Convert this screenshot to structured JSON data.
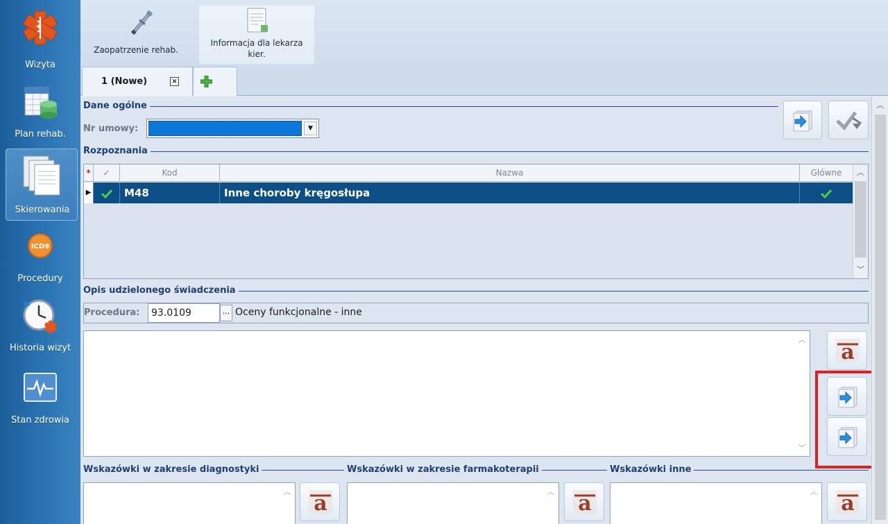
{
  "sidebar": {
    "items": [
      {
        "label": "Wizyta",
        "icon": "medical-star-icon",
        "active": false
      },
      {
        "label": "Plan rehab.",
        "icon": "calendar-database-icon",
        "active": false
      },
      {
        "label": "Skierowania",
        "icon": "documents-icon",
        "active": true
      },
      {
        "label": "Procedury",
        "icon": "icd9-icon",
        "active": false
      },
      {
        "label": "Historia wizyt",
        "icon": "clock-history-icon",
        "active": false
      },
      {
        "label": "Stan zdrowia",
        "icon": "heartbeat-monitor-icon",
        "active": false
      }
    ]
  },
  "toolbar": {
    "buttons": [
      {
        "label": "Zaopatrzenie rehab.",
        "icon": "crutch-icon"
      },
      {
        "label": "Informacja dla lekarza kier.",
        "icon": "document-info-icon",
        "active": true
      }
    ]
  },
  "tabs": {
    "items": [
      {
        "label": "1 (Nowe)",
        "close": "×"
      }
    ],
    "add_icon": "green-plus-icon"
  },
  "dane_ogolne": {
    "title": "Dane ogólne",
    "nr_umowy_label": "Nr umowy:",
    "nr_umowy_value": ""
  },
  "rozpoznania": {
    "title": "Rozpoznania",
    "columns": {
      "star": "*",
      "check": "✓",
      "kod": "Kod",
      "nazwa": "Nazwa",
      "glowne": "Główne"
    },
    "rows": [
      {
        "kod": "M48",
        "nazwa": "Inne choroby kręgosłupa",
        "checked": true,
        "glowne": true
      }
    ]
  },
  "opis": {
    "title": "Opis udzielonego świadczenia",
    "procedura_label": "Procedura:",
    "procedura_code": "93.0109",
    "procedura_button": "...",
    "procedura_name": "Oceny funkcjonalne - inne",
    "text": ""
  },
  "wskazowki": {
    "diagnostyki_title": "Wskazówki w zakresie diagnostyki",
    "farmakoterapii_title": "Wskazówki w zakresie farmakoterapii",
    "inne_title": "Wskazówki inne"
  },
  "colors": {
    "sidebar": "#2b74b3",
    "selected_row": "#0c4e86",
    "section_title": "#1f3f73",
    "highlight": "#e0201e"
  }
}
